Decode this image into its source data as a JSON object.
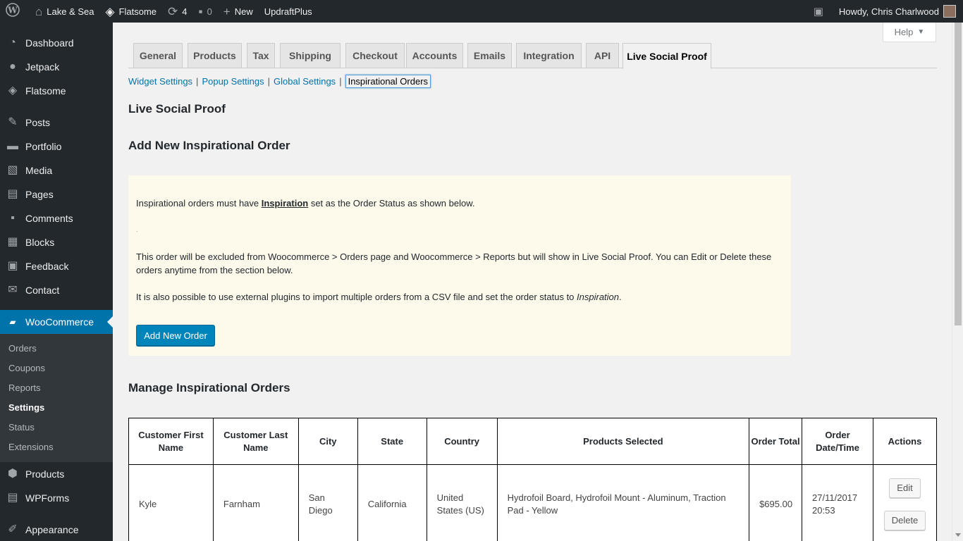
{
  "adminbar": {
    "site_name": "Lake & Sea",
    "theme": "Flatsome",
    "updates_count": "4",
    "comments_count": "0",
    "new_label": "New",
    "plugin_label": "UpdraftPlus",
    "howdy": "Howdy, Chris Charlwood"
  },
  "sidebar": {
    "items": [
      {
        "label": "Dashboard"
      },
      {
        "label": "Jetpack"
      },
      {
        "label": "Flatsome"
      },
      {
        "label": "Posts"
      },
      {
        "label": "Portfolio"
      },
      {
        "label": "Media"
      },
      {
        "label": "Pages"
      },
      {
        "label": "Comments"
      },
      {
        "label": "Blocks"
      },
      {
        "label": "Feedback"
      },
      {
        "label": "Contact"
      },
      {
        "label": "WooCommerce"
      },
      {
        "label": "Products"
      },
      {
        "label": "WPForms"
      },
      {
        "label": "Appearance"
      }
    ],
    "woo_submenu": [
      "Orders",
      "Coupons",
      "Reports",
      "Settings",
      "Status",
      "Extensions"
    ]
  },
  "help_label": "Help",
  "tabs": [
    "General",
    "Products",
    "Tax",
    "Shipping",
    "Checkout",
    "Accounts",
    "Emails",
    "Integration",
    "API",
    "Live Social Proof"
  ],
  "subtabs": [
    "Widget Settings",
    "Popup Settings",
    "Global Settings",
    "Inspirational Orders"
  ],
  "page_title": "Live Social Proof",
  "add_section_title": "Add New Inspirational Order",
  "notice": {
    "p1_before": "Inspirational orders must have ",
    "p1_link": "Inspiration",
    "p1_after": " set as the Order Status as shown below.",
    "dot": ".",
    "p2": "This order will be excluded from Woocommerce > Orders page and Woocommerce > Reports but will show in Live Social Proof. You can Edit or Delete these orders anytime from the section below.",
    "p3_before": "It is also possible to use external plugins to import multiple orders from a CSV file and set the order status to ",
    "p3_em": "Inspiration",
    "p3_after": ".",
    "button": "Add New Order"
  },
  "manage_title": "Manage Inspirational Orders",
  "table": {
    "headers": [
      "Customer First Name",
      "Customer Last Name",
      "City",
      "State",
      "Country",
      "Products Selected",
      "Order Total",
      "Order Date/Time",
      "Actions"
    ],
    "rows": [
      {
        "first": "Kyle",
        "last": "Farnham",
        "city": "San Diego",
        "state": "California",
        "country": "United States (US)",
        "products": "Hydrofoil Board, Hydrofoil Mount - Aluminum, Traction Pad - Yellow",
        "total": "$695.00",
        "datetime": "27/11/2017 20:53",
        "edit": "Edit",
        "delete": "Delete"
      }
    ]
  }
}
